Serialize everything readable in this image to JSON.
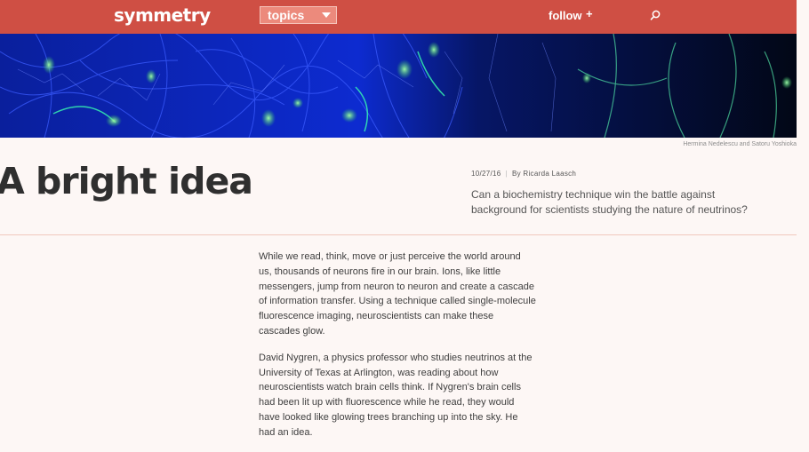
{
  "header": {
    "logo": "symmetry",
    "topics_label": "topics",
    "follow_label": "follow",
    "follow_plus": "+",
    "brand_color": "#cf4f44"
  },
  "hero": {
    "caption": "Hermina Nedelescu and Satoru Yoshioka"
  },
  "article": {
    "title": "A bright idea",
    "date": "10/27/16",
    "separator": "|",
    "byline": "By Ricarda Laasch",
    "dek": "Can a biochemistry technique win the battle against background for scientists studying the nature of neutrinos?",
    "paragraphs": [
      "While we read, think, move or just perceive the world around us, thousands of neurons fire in our brain. Ions, like little messengers, jump from neuron to neuron and create a cascade of information transfer. Using a technique called single-molecule fluorescence imaging, neuroscientists can make these cascades glow.",
      "David Nygren, a physics professor who studies neutrinos at the University of Texas at Arlington, was reading about how neuroscientists watch brain cells think. If Nygren's brain cells had been lit up with fluorescence while he read, they would have looked like glowing trees branching up into the sky. He had an idea."
    ]
  }
}
